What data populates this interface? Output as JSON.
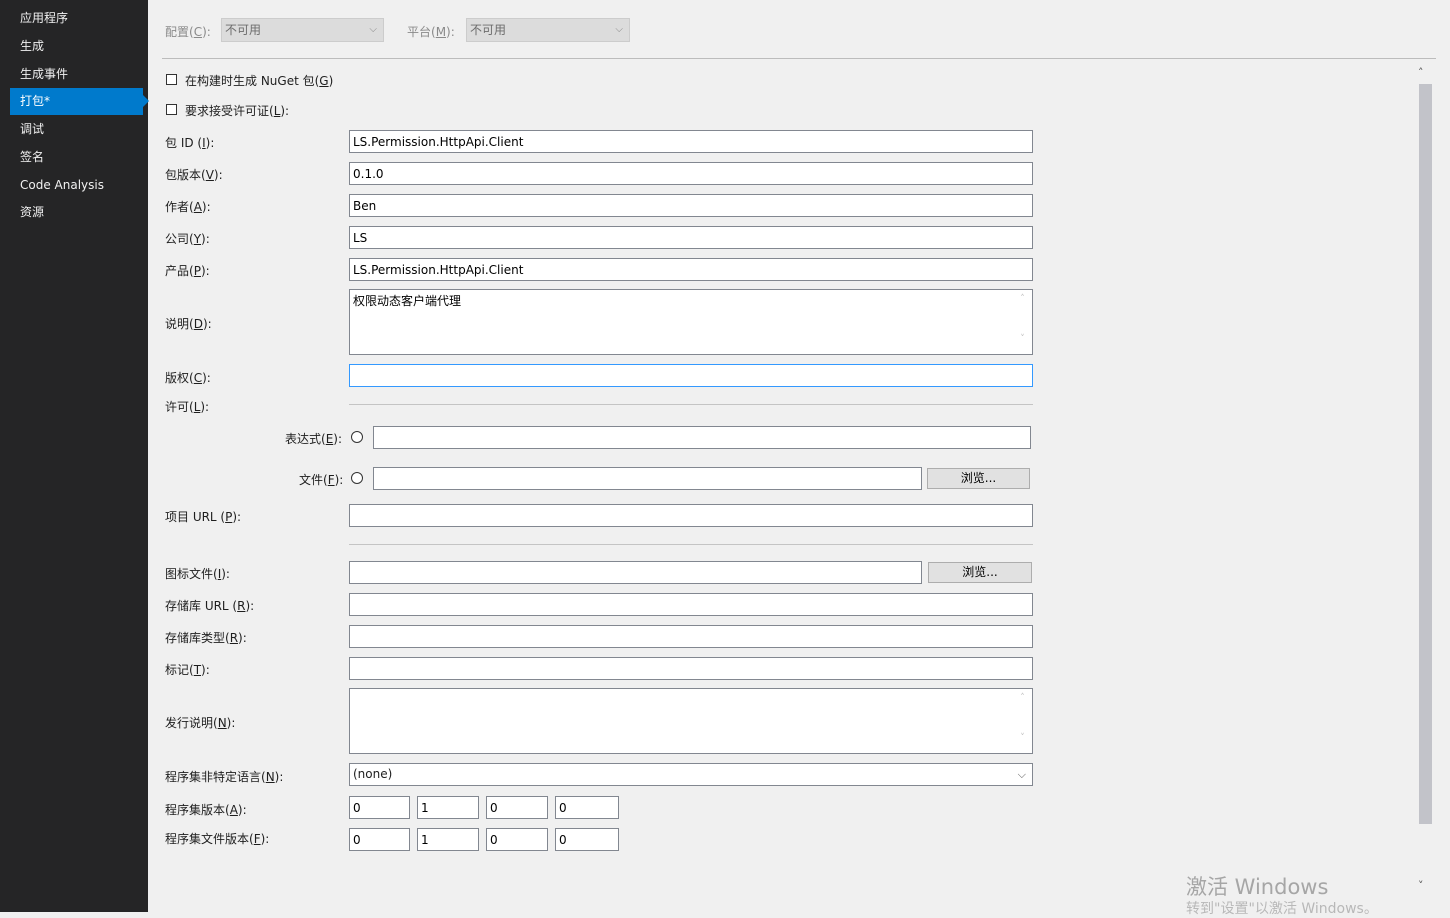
{
  "sidebar": {
    "items": [
      {
        "label": "应用程序"
      },
      {
        "label": "生成"
      },
      {
        "label": "生成事件"
      },
      {
        "label": "打包*"
      },
      {
        "label": "调试"
      },
      {
        "label": "签名"
      },
      {
        "label": "Code Analysis"
      },
      {
        "label": "资源"
      }
    ],
    "active_color": "#007acc"
  },
  "config": {
    "config_label": "配置(",
    "config_key": "C",
    "config_tail": "):",
    "config_value": "不可用",
    "platform_label": "平台(",
    "platform_key": "M",
    "platform_tail": "):",
    "platform_value": "不可用"
  },
  "form": {
    "nuget_checkbox": "在构建时生成 NuGet 包(",
    "nuget_key": "G",
    "nuget_tail": ")",
    "license_checkbox": "要求接受许可证(",
    "license_key": "L",
    "license_tail": "):",
    "package_id_label": "包 ID (",
    "package_id_key": "I",
    "package_id_tail": "):",
    "package_id": "LS.Permission.HttpApi.Client",
    "version_label": "包版本(",
    "version_key": "V",
    "version_tail": "):",
    "version": "0.1.0",
    "author_label": "作者(",
    "author_key": "A",
    "author_tail": "):",
    "author": "Ben",
    "company_label": "公司(",
    "company_key": "Y",
    "company_tail": "):",
    "company": "LS",
    "product_label": "产品(",
    "product_key": "P",
    "product_tail": "):",
    "product": "LS.Permission.HttpApi.Client",
    "description_label": "说明(",
    "description_key": "D",
    "description_tail": "):",
    "description": "权限动态客户端代理",
    "copyright_label": "版权(",
    "copyright_key": "C",
    "copyright_tail": "):",
    "copyright": "",
    "license_label": "许可(",
    "expression_label": "表达式(",
    "expression_key": "E",
    "expression_tail": "):",
    "expression": "",
    "file_label": "文件(",
    "file_key": "F",
    "file_tail": "):",
    "file": "",
    "browse_label": "浏览...",
    "project_url_label": "项目 URL (",
    "project_url_key": "P",
    "project_url_tail": "):",
    "project_url": "",
    "icon_label": "图标文件(",
    "icon_key": "I",
    "icon_tail": "):",
    "icon_file": "",
    "repo_url_label": "存储库 URL (",
    "repo_url_key": "R",
    "repo_url_tail": "):",
    "repo_url": "",
    "repo_type_label": "存储库类型(",
    "repo_type_key": "R",
    "repo_type_tail": "):",
    "repo_type": "",
    "tags_label": "标记(",
    "tags_key": "T",
    "tags_tail": "):",
    "tags": "",
    "release_notes_label": "发行说明(",
    "release_notes_key": "N",
    "release_notes_tail": "):",
    "release_notes": "",
    "neutral_lang_label": "程序集非特定语言(",
    "neutral_lang_key": "N",
    "neutral_lang_tail": "):",
    "neutral_lang": "(none)",
    "assembly_version_label": "程序集版本(",
    "assembly_version_key": "A",
    "assembly_version_tail": "):",
    "assembly_version": [
      "0",
      "1",
      "0",
      "0"
    ],
    "file_version_label": "程序集文件版本(",
    "file_version_key": "F",
    "file_version_tail": "):",
    "file_version": [
      "0",
      "1",
      "0",
      "0"
    ]
  },
  "watermark": {
    "line1": "激活 Windows",
    "line2": "转到\"设置\"以激活 Windows。"
  }
}
